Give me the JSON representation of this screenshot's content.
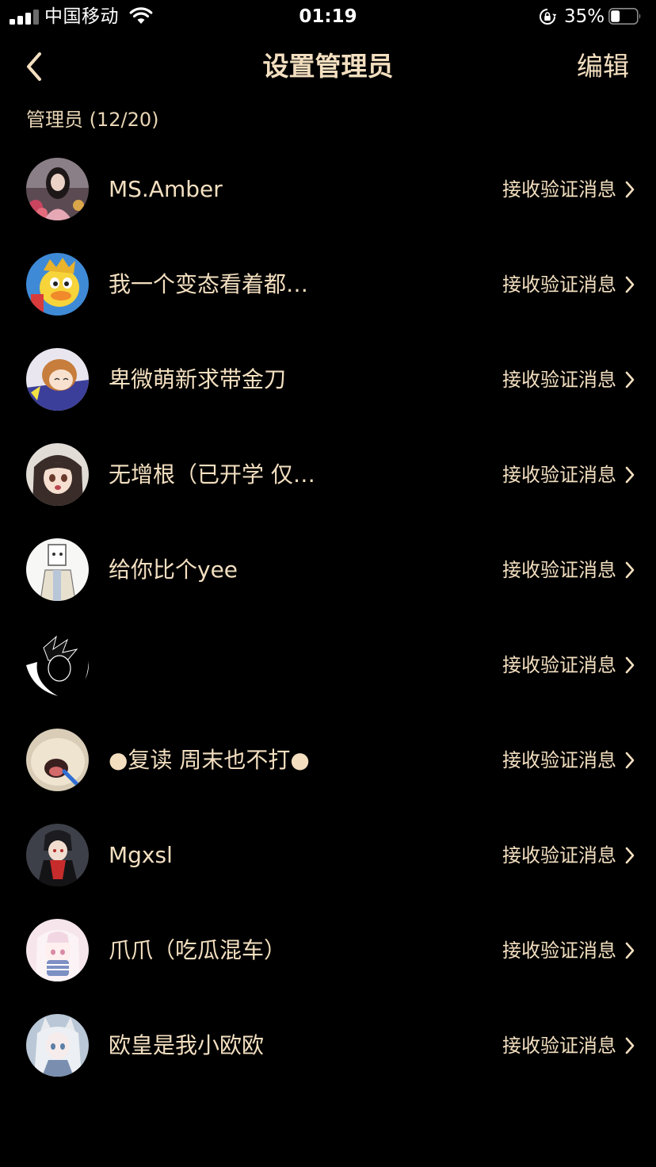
{
  "status_bar": {
    "carrier": "中国移动",
    "time": "01:19",
    "battery_percent": "35%",
    "battery_level": 0.35,
    "signal_bars": 3,
    "icons": [
      "signal-icon",
      "wifi-icon",
      "rotation-lock-icon",
      "battery-icon"
    ]
  },
  "nav": {
    "back_icon": "chevron-left-icon",
    "title": "设置管理员",
    "edit_label": "编辑"
  },
  "section": {
    "header": "管理员 (12/20)"
  },
  "admins": [
    {
      "name": "MS.Amber",
      "action": "接收验证消息"
    },
    {
      "name": "我一个变态看着都…",
      "action": "接收验证消息"
    },
    {
      "name": "卑微萌新求带金刀",
      "action": "接收验证消息"
    },
    {
      "name": "无增根（已开学 仅…",
      "action": "接收验证消息"
    },
    {
      "name": "给你比个yee",
      "action": "接收验证消息"
    },
    {
      "name": "",
      "action": "接收验证消息"
    },
    {
      "name": "●复读 周末也不打●",
      "action": "接收验证消息"
    },
    {
      "name": "Mgxsl",
      "action": "接收验证消息"
    },
    {
      "name": "爪爪（吃瓜混车）",
      "action": "接收验证消息"
    },
    {
      "name": "欧皇是我小欧欧",
      "action": "接收验证消息"
    }
  ],
  "colors": {
    "background": "#000000",
    "accent_text": "#f3dfc0",
    "status_text": "#ffffff"
  }
}
